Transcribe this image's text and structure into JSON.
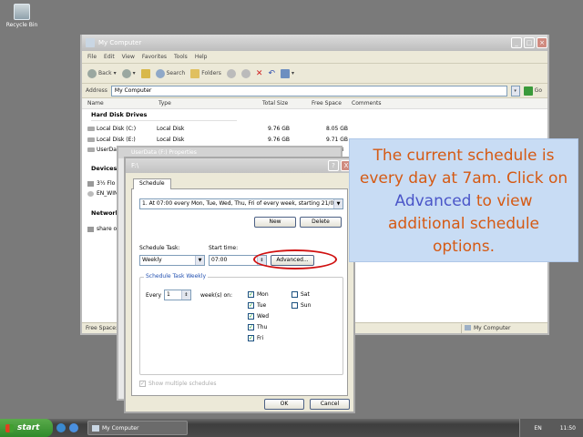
{
  "desktop": {
    "recycle_bin": "Recycle Bin"
  },
  "explorer": {
    "title": "My Computer",
    "menu": [
      "File",
      "Edit",
      "View",
      "Favorites",
      "Tools",
      "Help"
    ],
    "toolbar": {
      "back": "Back",
      "search": "Search",
      "folders": "Folders"
    },
    "address_label": "Address",
    "address_value": "My Computer",
    "go": "Go",
    "columns": {
      "name": "Name",
      "type": "Type",
      "total_size": "Total Size",
      "free_space": "Free Space",
      "comments": "Comments"
    },
    "group_hdd": "Hard Disk Drives",
    "drives": [
      {
        "name": "Local Disk (C:)",
        "type": "Local Disk",
        "total": "9.76 GB",
        "free": "8.05 GB"
      },
      {
        "name": "Local Disk (E:)",
        "type": "Local Disk",
        "total": "9.76 GB",
        "free": "9.71 GB"
      },
      {
        "name": "UserData (F:)",
        "type": "",
        "total": "",
        "free": "MB"
      }
    ],
    "group_devices": "Devices",
    "devices": [
      "3½ Flo",
      "EN_WIN"
    ],
    "group_network": "Network",
    "network": [
      "share o"
    ],
    "status_left": "Free Space:",
    "status_right": "My Computer"
  },
  "properties_title": "UserData (F:) Properties",
  "dialog": {
    "title": "F:\\",
    "help": "?",
    "close": "X",
    "tab": "Schedule",
    "schedule_item": "1. At 07:00 every Mon, Tue, Wed, Thu, Fri of every week, starting 21/0",
    "new": "New",
    "delete": "Delete",
    "schedule_task_label": "Schedule Task:",
    "schedule_task_value": "Weekly",
    "start_time_label": "Start time:",
    "start_time_value": "07:00",
    "advanced": "Advanced...",
    "group_title": "Schedule Task Weekly",
    "every": "Every",
    "every_value": "1",
    "weeks_on": "week(s) on:",
    "days": [
      {
        "label": "Mon",
        "checked": true
      },
      {
        "label": "Tue",
        "checked": true
      },
      {
        "label": "Wed",
        "checked": true
      },
      {
        "label": "Thu",
        "checked": true
      },
      {
        "label": "Fri",
        "checked": true
      },
      {
        "label": "Sat",
        "checked": false
      },
      {
        "label": "Sun",
        "checked": false
      }
    ],
    "show_multiple": "Show multiple schedules",
    "ok": "OK",
    "cancel": "Cancel"
  },
  "callout": {
    "part1": "The current schedule is every day at 7am. Click on ",
    "highlight": "Advanced",
    "part2": " to view additional schedule options."
  },
  "taskbar": {
    "start": "start",
    "task": "My Computer",
    "lang": "EN",
    "clock": "11:50"
  },
  "colors": {
    "callout_text": "#d55a14",
    "callout_highlight": "#4a55c8",
    "callout_bg": "#c8dcf4",
    "ring": "#d01010",
    "start_green": "#3e9a36"
  }
}
